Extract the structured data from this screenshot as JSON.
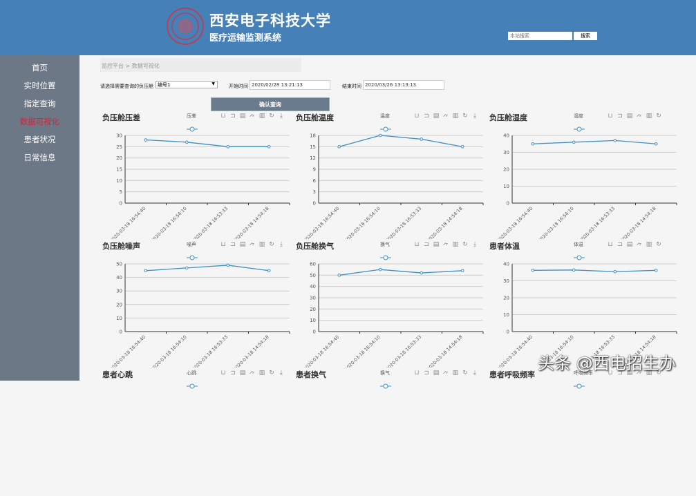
{
  "header": {
    "title": "西安电子科技大学",
    "subtitle": "医疗运输监测系统",
    "search_placeholder": "本站搜索",
    "search_button": "搜索"
  },
  "sidebar": {
    "items": [
      {
        "label": "首页"
      },
      {
        "label": "实时位置"
      },
      {
        "label": "指定查询"
      },
      {
        "label": "数据可视化",
        "active": true
      },
      {
        "label": "患者状况"
      },
      {
        "label": "日常信息"
      }
    ]
  },
  "breadcrumb": "监控平台 > 数据可视化",
  "form": {
    "select_label": "请选择需要查询的负压舱",
    "select_value": "编号1",
    "start_label": "开始时间",
    "start_value": "2020/02/28 13:21:13",
    "end_label": "结束时间",
    "end_value": "2020/03/26 13:13:13",
    "confirm": "确认查询"
  },
  "colors": {
    "header": "#4580b8",
    "sidebar": "#6c7886",
    "active": "#d4233a",
    "line": "#3d8fc4"
  },
  "toolbar_icons": [
    "zoom-icon",
    "zoom-reset-icon",
    "data-view-icon",
    "line-chart-icon",
    "bar-chart-icon",
    "restore-icon",
    "download-icon"
  ],
  "watermark": "头条 @西电招生办",
  "chart_data": [
    {
      "type": "line",
      "title": "负压舱压差",
      "legend": "压差",
      "categories": [
        "2020-03-18 16:54:40",
        "2020-03-18 16:54:10",
        "2020-03-18 16:53:33",
        "2020-03-18 14:54:18"
      ],
      "values": [
        28,
        27,
        25,
        25
      ],
      "ylim": [
        0,
        30
      ],
      "yticks": [
        0,
        5,
        10,
        15,
        20,
        25,
        30
      ],
      "download": true
    },
    {
      "type": "line",
      "title": "负压舱温度",
      "legend": "温度",
      "categories": [
        "2020-03-18 16:54:40",
        "2020-03-18 16:54:10",
        "2020-03-18 16:53:33",
        "2020-03-18 14:54:18"
      ],
      "values": [
        15,
        18,
        17,
        15
      ],
      "ylim": [
        0,
        18
      ],
      "yticks": [
        0,
        3,
        6,
        9,
        12,
        15,
        18
      ],
      "download": true
    },
    {
      "type": "line",
      "title": "负压舱湿度",
      "legend": "湿度",
      "categories": [
        "2020-03-18 16:54:40",
        "2020-03-18 16:54:10",
        "2020-03-18 16:53:33",
        "2020-03-18 14:54:18"
      ],
      "values": [
        35,
        36,
        37,
        35
      ],
      "ylim": [
        0,
        40
      ],
      "yticks": [
        0,
        10,
        20,
        30,
        40
      ],
      "download": false
    },
    {
      "type": "line",
      "title": "负压舱噪声",
      "legend": "噪声",
      "categories": [
        "2020-03-18 16:54:40",
        "2020-03-18 16:54:10",
        "2020-03-18 16:53:33",
        "2020-03-18 14:54:18"
      ],
      "values": [
        45,
        47,
        49,
        45
      ],
      "ylim": [
        0,
        50
      ],
      "yticks": [
        0,
        10,
        20,
        30,
        40,
        50
      ],
      "download": true
    },
    {
      "type": "line",
      "title": "负压舱换气",
      "legend": "换气",
      "categories": [
        "2020-03-18 16:54:40",
        "2020-03-18 16:54:10",
        "2020-03-18 16:53:33",
        "2020-03-18 14:54:18"
      ],
      "values": [
        50,
        55,
        52,
        54
      ],
      "ylim": [
        0,
        60
      ],
      "yticks": [
        0,
        10,
        20,
        30,
        40,
        50,
        60
      ],
      "download": true
    },
    {
      "type": "line",
      "title": "患者体温",
      "legend": "体温",
      "categories": [
        "2020-03-18 16:54:40",
        "2020-03-18 16:54:10",
        "2020-03-18 16:53:33",
        "2020-03-18 14:54:18"
      ],
      "values": [
        36.2,
        36.4,
        35.4,
        36.2
      ],
      "ylim": [
        0,
        40
      ],
      "yticks": [
        0,
        10,
        20,
        30,
        40
      ],
      "download": false
    },
    {
      "type": "line",
      "title": "患者心跳",
      "legend": "心跳",
      "categories": [],
      "values": [],
      "download": true
    },
    {
      "type": "line",
      "title": "患者换气",
      "legend": "换气",
      "categories": [],
      "values": [],
      "download": true
    },
    {
      "type": "line",
      "title": "患者呼吸频率",
      "legend": "呼吸频率",
      "categories": [],
      "values": [],
      "download": false
    }
  ]
}
